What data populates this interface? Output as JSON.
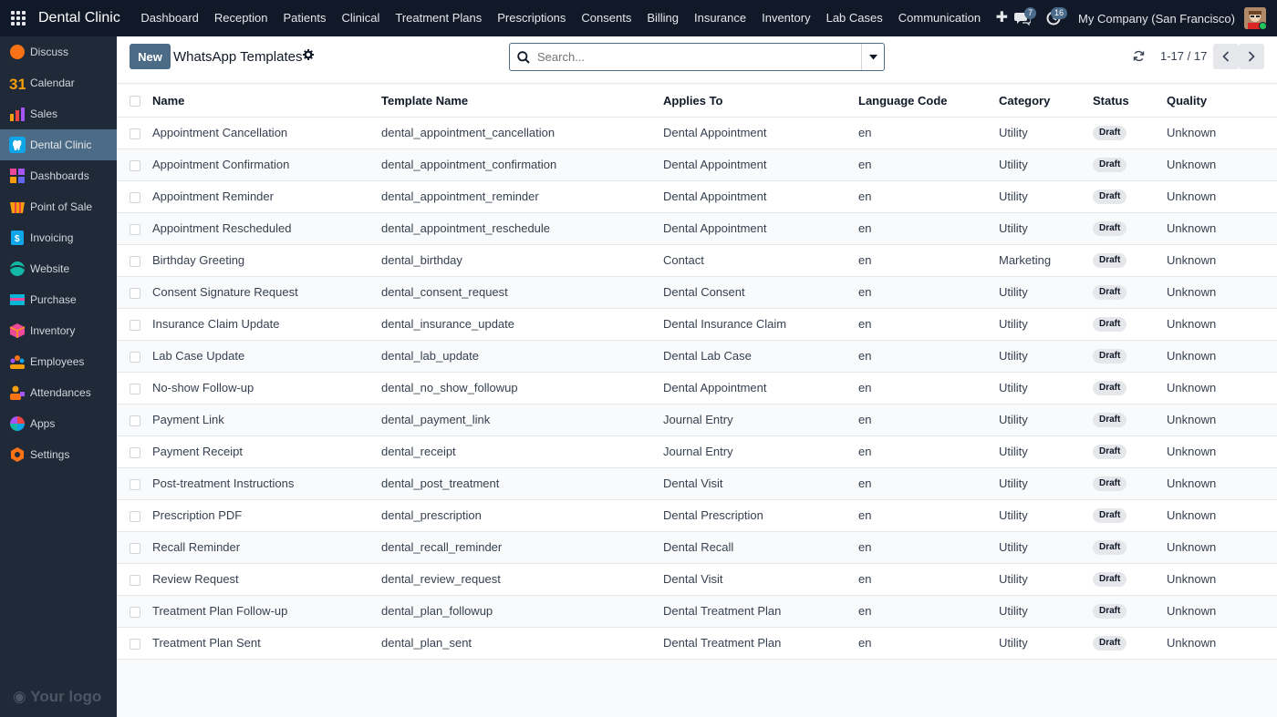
{
  "topbar": {
    "brand": "Dental Clinic",
    "menu": [
      "Dashboard",
      "Reception",
      "Patients",
      "Clinical",
      "Treatment Plans",
      "Prescriptions",
      "Consents",
      "Billing",
      "Insurance",
      "Inventory",
      "Lab Cases",
      "Communication"
    ],
    "messages_count": "7",
    "activities_count": "16",
    "company": "My Company (San Francisco)"
  },
  "sidebar": {
    "items": [
      {
        "label": "Discuss",
        "icon": "discuss-icon",
        "color": "#f97316"
      },
      {
        "label": "Calendar",
        "icon": "calendar-icon",
        "color": "#f59e0b"
      },
      {
        "label": "Sales",
        "icon": "sales-icon",
        "color": "#ef4444"
      },
      {
        "label": "Dental Clinic",
        "icon": "tooth-icon",
        "color": "#ffffff"
      },
      {
        "label": "Dashboards",
        "icon": "dashboards-icon",
        "color": "#ec4899"
      },
      {
        "label": "Point of Sale",
        "icon": "point-of-sale-icon",
        "color": "#f59e0b"
      },
      {
        "label": "Invoicing",
        "icon": "invoicing-icon",
        "color": "#0ea5e9"
      },
      {
        "label": "Website",
        "icon": "website-icon",
        "color": "#14b8a6"
      },
      {
        "label": "Purchase",
        "icon": "purchase-icon",
        "color": "#06b6d4"
      },
      {
        "label": "Inventory",
        "icon": "inventory-icon",
        "color": "#ec4899"
      },
      {
        "label": "Employees",
        "icon": "employees-icon",
        "color": "#f97316"
      },
      {
        "label": "Attendances",
        "icon": "attendances-icon",
        "color": "#f59e0b"
      },
      {
        "label": "Apps",
        "icon": "apps-icon",
        "color": "#ef4444"
      },
      {
        "label": "Settings",
        "icon": "settings-icon",
        "color": "#f97316"
      }
    ],
    "active_index": 3,
    "logo_text": "Your logo"
  },
  "control": {
    "new_label": "New",
    "title": "WhatsApp Templates",
    "search_placeholder": "Search...",
    "pager": "1-17 / 17"
  },
  "table": {
    "headers": [
      "Name",
      "Template Name",
      "Applies To",
      "Language Code",
      "Category",
      "Status",
      "Quality"
    ],
    "rows": [
      [
        "Appointment Cancellation",
        "dental_appointment_cancellation",
        "Dental Appointment",
        "en",
        "Utility",
        "Draft",
        "Unknown"
      ],
      [
        "Appointment Confirmation",
        "dental_appointment_confirmation",
        "Dental Appointment",
        "en",
        "Utility",
        "Draft",
        "Unknown"
      ],
      [
        "Appointment Reminder",
        "dental_appointment_reminder",
        "Dental Appointment",
        "en",
        "Utility",
        "Draft",
        "Unknown"
      ],
      [
        "Appointment Rescheduled",
        "dental_appointment_reschedule",
        "Dental Appointment",
        "en",
        "Utility",
        "Draft",
        "Unknown"
      ],
      [
        "Birthday Greeting",
        "dental_birthday",
        "Contact",
        "en",
        "Marketing",
        "Draft",
        "Unknown"
      ],
      [
        "Consent Signature Request",
        "dental_consent_request",
        "Dental Consent",
        "en",
        "Utility",
        "Draft",
        "Unknown"
      ],
      [
        "Insurance Claim Update",
        "dental_insurance_update",
        "Dental Insurance Claim",
        "en",
        "Utility",
        "Draft",
        "Unknown"
      ],
      [
        "Lab Case Update",
        "dental_lab_update",
        "Dental Lab Case",
        "en",
        "Utility",
        "Draft",
        "Unknown"
      ],
      [
        "No-show Follow-up",
        "dental_no_show_followup",
        "Dental Appointment",
        "en",
        "Utility",
        "Draft",
        "Unknown"
      ],
      [
        "Payment Link",
        "dental_payment_link",
        "Journal Entry",
        "en",
        "Utility",
        "Draft",
        "Unknown"
      ],
      [
        "Payment Receipt",
        "dental_receipt",
        "Journal Entry",
        "en",
        "Utility",
        "Draft",
        "Unknown"
      ],
      [
        "Post-treatment Instructions",
        "dental_post_treatment",
        "Dental Visit",
        "en",
        "Utility",
        "Draft",
        "Unknown"
      ],
      [
        "Prescription PDF",
        "dental_prescription",
        "Dental Prescription",
        "en",
        "Utility",
        "Draft",
        "Unknown"
      ],
      [
        "Recall Reminder",
        "dental_recall_reminder",
        "Dental Recall",
        "en",
        "Utility",
        "Draft",
        "Unknown"
      ],
      [
        "Review Request",
        "dental_review_request",
        "Dental Visit",
        "en",
        "Utility",
        "Draft",
        "Unknown"
      ],
      [
        "Treatment Plan Follow-up",
        "dental_plan_followup",
        "Dental Treatment Plan",
        "en",
        "Utility",
        "Draft",
        "Unknown"
      ],
      [
        "Treatment Plan Sent",
        "dental_plan_sent",
        "Dental Treatment Plan",
        "en",
        "Utility",
        "Draft",
        "Unknown"
      ]
    ]
  }
}
